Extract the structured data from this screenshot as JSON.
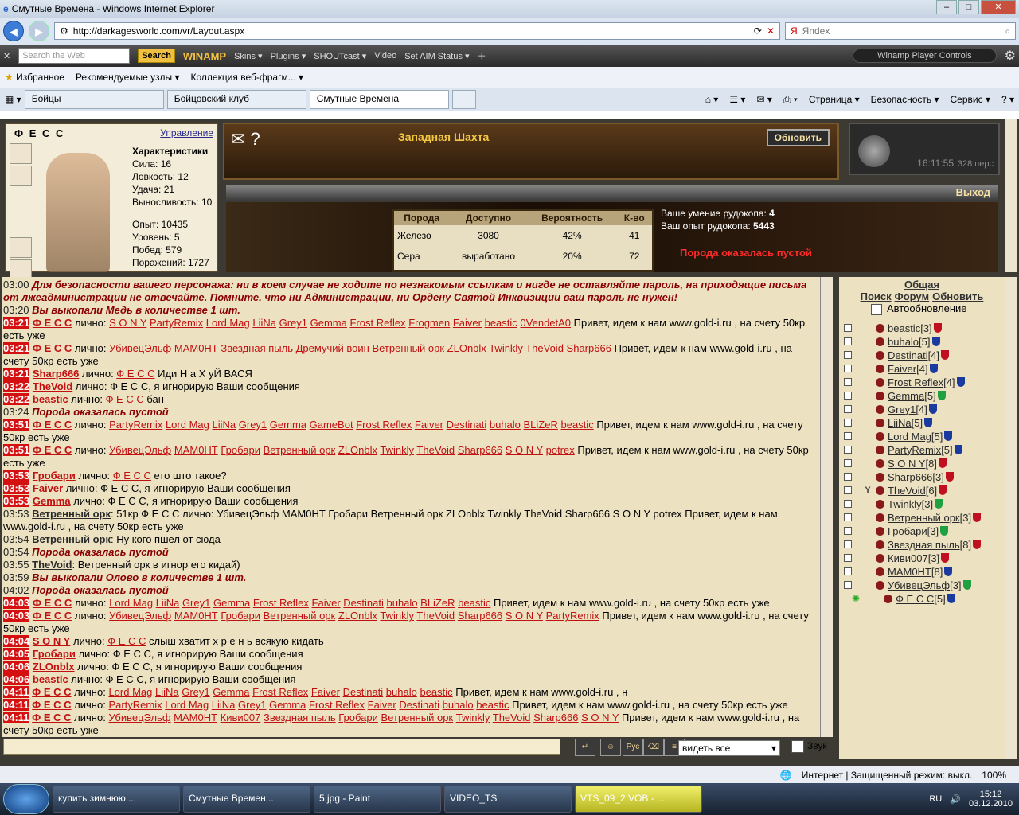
{
  "window": {
    "title": "Смутные Времена - Windows Internet Explorer"
  },
  "addr": {
    "url": "http://darkagesworld.com/vr/Layout.aspx",
    "search_placeholder": "Яndex"
  },
  "winamp": {
    "search_placeholder": "Search the Web",
    "search_btn": "Search",
    "logo": "WINAMP",
    "menus": [
      "Skins ▾",
      "Plugins ▾",
      "SHOUTcast ▾",
      "Video",
      "Set AIM Status ▾"
    ],
    "player_controls": "Winamp Player Controls"
  },
  "fav": {
    "favorites": "Избранное",
    "suggested": "Рекомендуемые узлы ▾",
    "gallery": "Коллекция веб-фрагм... ▾"
  },
  "tabs": [
    "Бойцы",
    "Бойцовский клуб",
    "Смутные Времена"
  ],
  "cmd": {
    "page": "Страница ▾",
    "safety": "Безопасность ▾",
    "service": "Сервис ▾"
  },
  "char": {
    "name": "Ф Е С С",
    "manage": "Управление",
    "heading": "Характеристики",
    "stats": [
      "Сила: 16",
      "Ловкость: 12",
      "Удача: 21",
      "Выносливость: 10"
    ],
    "info": [
      "Опыт: 10435",
      "Уровень: 5",
      "Побед: 579",
      "Поражений: 1727"
    ]
  },
  "banner": {
    "location": "Западная Шахта",
    "update": "Обновить",
    "exit": "Выход"
  },
  "clock": {
    "time": "16:11:55",
    "persons": "328 перс"
  },
  "ore": {
    "headers": [
      "Порода",
      "Доступно",
      "Вероятность",
      "К-во"
    ],
    "rows": [
      [
        "Железо",
        "3080",
        "42%",
        "41"
      ],
      [
        "Сера",
        "выработано",
        "20%",
        "72"
      ]
    ]
  },
  "skill": {
    "label1": "Ваше умение рудокопа:",
    "val1": "4",
    "label2": "Ваш опыт рудокопа:",
    "val2": "5443",
    "empty": "Порода оказалась пустой"
  },
  "chat": [
    {
      "t": "03:00",
      "hot": false,
      "sys": "Для безопасности вашего персонажа: ни в коем случае не ходите по незнакомым ссылкам и нигде не оставляйте пароль, на приходящие письма от лжеадминистрации не отвечайте. Помните, что ни Администрации, ни Ордену Святой Инквизиции ваш пароль не нужен!"
    },
    {
      "t": "03:20",
      "hot": false,
      "sys": "Вы выкопали Медь в количестве 1 шт."
    },
    {
      "t": "03:21",
      "hot": true,
      "who": "Ф Е С С",
      "mid": " лично: ",
      "names": [
        "S O N Y",
        "PartyRemix",
        "Lord Mag",
        "LiiNa",
        "Grey1",
        "Gemma",
        "Frost Reflex",
        "Frogmen",
        "Faiver",
        "beastic",
        "0VendetA0"
      ],
      "text": " Привет, идем к нам www.gold-i.ru , на счету 50кр есть уже"
    },
    {
      "t": "03:21",
      "hot": true,
      "who": "Ф Е С С",
      "mid": " лично: ",
      "names": [
        "УбивецЭльф",
        "МАМ0НТ",
        "Звездная пыль",
        "Дремучий воин",
        "Ветренный орк",
        "ZLOnblx",
        "Twinkly",
        "TheVoid",
        "Sharp666"
      ],
      "text": " Привет, идем к нам www.gold-i.ru , на счету 50кр есть уже"
    },
    {
      "t": "03:21",
      "hot": true,
      "who": "Sharp666",
      "mid": " лично: ",
      "names": [
        "Ф Е С С"
      ],
      "text": " Иди Н а Х уЙ ВАСЯ"
    },
    {
      "t": "03:22",
      "hot": true,
      "who": "TheVoid",
      "mid": " лично: ",
      "names": [],
      "text": "Ф Е С С, я игнорирую Ваши сообщения"
    },
    {
      "t": "03:22",
      "hot": true,
      "who": "beastic",
      "mid": " лично: ",
      "names": [
        "Ф Е С С"
      ],
      "text": " бан"
    },
    {
      "t": "03:24",
      "hot": false,
      "sys": "Порода оказалась пустой"
    },
    {
      "t": "03:51",
      "hot": true,
      "who": "Ф Е С С",
      "mid": " лично: ",
      "names": [
        "PartyRemix",
        "Lord Mag",
        "LiiNa",
        "Grey1",
        "Gemma",
        "GameBot",
        "Frost Reflex",
        "Faiver",
        "Destinati",
        "buhalo",
        "BLiZeR",
        "beastic"
      ],
      "text": " Привет, идем к нам www.gold-i.ru , на счету 50кр есть уже"
    },
    {
      "t": "03:51",
      "hot": true,
      "who": "Ф Е С С",
      "mid": " лично: ",
      "names": [
        "УбивецЭльф",
        "МАМ0НТ",
        "Гробари",
        "Ветренный орк",
        "ZLOnblx",
        "Twinkly",
        "TheVoid",
        "Sharp666",
        "S O N Y",
        "potrex"
      ],
      "text": " Привет, идем к нам www.gold-i.ru , на счету 50кр есть уже"
    },
    {
      "t": "03:53",
      "hot": true,
      "who": "Гробари",
      "mid": " лично: ",
      "names": [
        "Ф Е С С"
      ],
      "text": " ето што такое?"
    },
    {
      "t": "03:53",
      "hot": true,
      "who": "Faiver",
      "mid": " лично: ",
      "names": [],
      "text": "Ф Е С С, я игнорирую Ваши сообщения"
    },
    {
      "t": "03:53",
      "hot": true,
      "who": "Gemma",
      "mid": " лично: ",
      "names": [],
      "text": "Ф Е С С, я игнорирую Ваши сообщения"
    },
    {
      "t": "03:53",
      "hot": false,
      "plain": "Ветренный орк",
      "text": ": 51кр Ф Е С С лично: УбивецЭльф МАМ0НТ Гробари Ветренный орк ZLOnblx Twinkly TheVoid Sharp666 S O N Y potrex Привет, идем к нам www.gold-i.ru , на счету 50кр есть уже"
    },
    {
      "t": "03:54",
      "hot": false,
      "plain": "Ветренный орк",
      "text": ": Ну кого пшел от сюда"
    },
    {
      "t": "03:54",
      "hot": false,
      "sys": "Порода оказалась пустой"
    },
    {
      "t": "03:55",
      "hot": false,
      "plain": "TheVoid",
      "text": ": Ветренный орк в игнор его кидай)"
    },
    {
      "t": "03:59",
      "hot": false,
      "sys": "Вы выкопали Олово в количестве 1 шт."
    },
    {
      "t": "04:02",
      "hot": false,
      "sys": "Порода оказалась пустой"
    },
    {
      "t": "04:03",
      "hot": true,
      "who": "Ф Е С С",
      "mid": " лично: ",
      "names": [
        "Lord Mag",
        "LiiNa",
        "Grey1",
        "Gemma",
        "Frost Reflex",
        "Faiver",
        "Destinati",
        "buhalo",
        "BLiZeR",
        "beastic"
      ],
      "text": " Привет, идем к нам www.gold-i.ru , на счету 50кр есть уже"
    },
    {
      "t": "04:03",
      "hot": true,
      "who": "Ф Е С С",
      "mid": " лично: ",
      "names": [
        "УбивецЭльф",
        "МАМ0НТ",
        "Гробари",
        "Ветренный орк",
        "ZLOnblx",
        "Twinkly",
        "TheVoid",
        "Sharp666",
        "S O N Y",
        "PartyRemix"
      ],
      "text": " Привет, идем к нам www.gold-i.ru , на счету 50кр есть уже"
    },
    {
      "t": "04:04",
      "hot": true,
      "who": "S O N Y",
      "mid": " лично: ",
      "names": [
        "Ф Е С С"
      ],
      "text": " слыш хватит х р е н ь всякую кидать"
    },
    {
      "t": "04:05",
      "hot": true,
      "who": "Гробари",
      "mid": " лично: ",
      "names": [],
      "text": "Ф Е С С, я игнорирую Ваши сообщения"
    },
    {
      "t": "04:06",
      "hot": true,
      "who": "ZLOnblx",
      "mid": " лично: ",
      "names": [],
      "text": "Ф Е С С, я игнорирую Ваши сообщения"
    },
    {
      "t": "04:06",
      "hot": true,
      "who": "beastic",
      "mid": " лично: ",
      "names": [],
      "text": "Ф Е С С, я игнорирую Ваши сообщения"
    },
    {
      "t": "04:11",
      "hot": true,
      "who": "Ф Е С С",
      "mid": " лично: ",
      "names": [
        "Lord Mag",
        "LiiNa",
        "Grey1",
        "Gemma",
        "Frost Reflex",
        "Faiver",
        "Destinati",
        "buhalo",
        "beastic"
      ],
      "text": " Привет, идем к нам www.gold-i.ru , н"
    },
    {
      "t": "04:11",
      "hot": true,
      "who": "Ф Е С С",
      "mid": " лично: ",
      "names": [
        "PartyRemix",
        "Lord Mag",
        "LiiNa",
        "Grey1",
        "Gemma",
        "Frost Reflex",
        "Faiver",
        "Destinati",
        "buhalo",
        "beastic"
      ],
      "text": " Привет, идем к нам www.gold-i.ru , на счету 50кр есть уже"
    },
    {
      "t": "04:11",
      "hot": true,
      "who": "Ф Е С С",
      "mid": " лично: ",
      "names": [
        "УбивецЭльф",
        "МАМ0НТ",
        "Киви007",
        "Звездная пыль",
        "Гробари",
        "Ветренный орк",
        "Twinkly",
        "TheVoid",
        "Sharp666",
        "S O N Y"
      ],
      "text": " Привет, идем к нам www.gold-i.ru , на счету 50кр есть уже"
    }
  ],
  "input": {
    "filter": "видеть все",
    "sound": "Звук"
  },
  "users": {
    "header": "Общая",
    "links": [
      "Поиск",
      "Форум",
      "Обновить"
    ],
    "auto": "Автообновление",
    "list": [
      {
        "n": "beastic",
        "l": "[3]",
        "c": "#c01020"
      },
      {
        "n": "buhalo",
        "l": "[5]",
        "c": "#1a3aa0"
      },
      {
        "n": "Destinati",
        "l": "[4]",
        "c": "#c01020"
      },
      {
        "n": "Faiver",
        "l": "[4]",
        "c": "#1a3aa0"
      },
      {
        "n": "Frost Reflex",
        "l": "[4]",
        "c": "#1a3aa0"
      },
      {
        "n": "Gemma",
        "l": "[5]",
        "c": "#20a040"
      },
      {
        "n": "Grey1",
        "l": "[4]",
        "c": "#1a3aa0"
      },
      {
        "n": "LiiNa",
        "l": "[5]",
        "c": "#1a3aa0"
      },
      {
        "n": "Lord Mag",
        "l": "[5]",
        "c": "#1a3aa0"
      },
      {
        "n": "PartyRemix",
        "l": "[5]",
        "c": "#1a3aa0"
      },
      {
        "n": "S O N Y",
        "l": "[8]",
        "c": "#c01020"
      },
      {
        "n": "Sharp666",
        "l": "[3]",
        "c": "#c01020"
      },
      {
        "n": "TheVoid",
        "l": "[6]",
        "c": "#c01020"
      },
      {
        "n": "Twinkly",
        "l": "[3]",
        "c": "#20a040"
      },
      {
        "n": "Ветренный орк",
        "l": "[3]",
        "c": "#c01020"
      },
      {
        "n": "Гробари",
        "l": "[3]",
        "c": "#20a040"
      },
      {
        "n": "Звездная пыль",
        "l": "[8]",
        "c": "#c01020"
      },
      {
        "n": "Киви007",
        "l": "[3]",
        "c": "#c01020"
      },
      {
        "n": "МАМ0НТ",
        "l": "[8]",
        "c": "#1a3aa0"
      },
      {
        "n": "УбивецЭльф",
        "l": "[3]",
        "c": "#20a040"
      },
      {
        "n": "Ф Е С С",
        "l": "[5]",
        "c": "#1a3aa0"
      }
    ]
  },
  "status": {
    "zone": "Интернет | Защищенный режим: выкл.",
    "zoom": "100%"
  },
  "taskbar": {
    "items": [
      "купить зимнюю ...",
      "Смутные Времен...",
      "5.jpg - Paint",
      "VIDEO_TS",
      "VTS_09_2.VOB - ..."
    ],
    "lang": "RU",
    "time": "15:12",
    "date": "03.12.2010"
  }
}
